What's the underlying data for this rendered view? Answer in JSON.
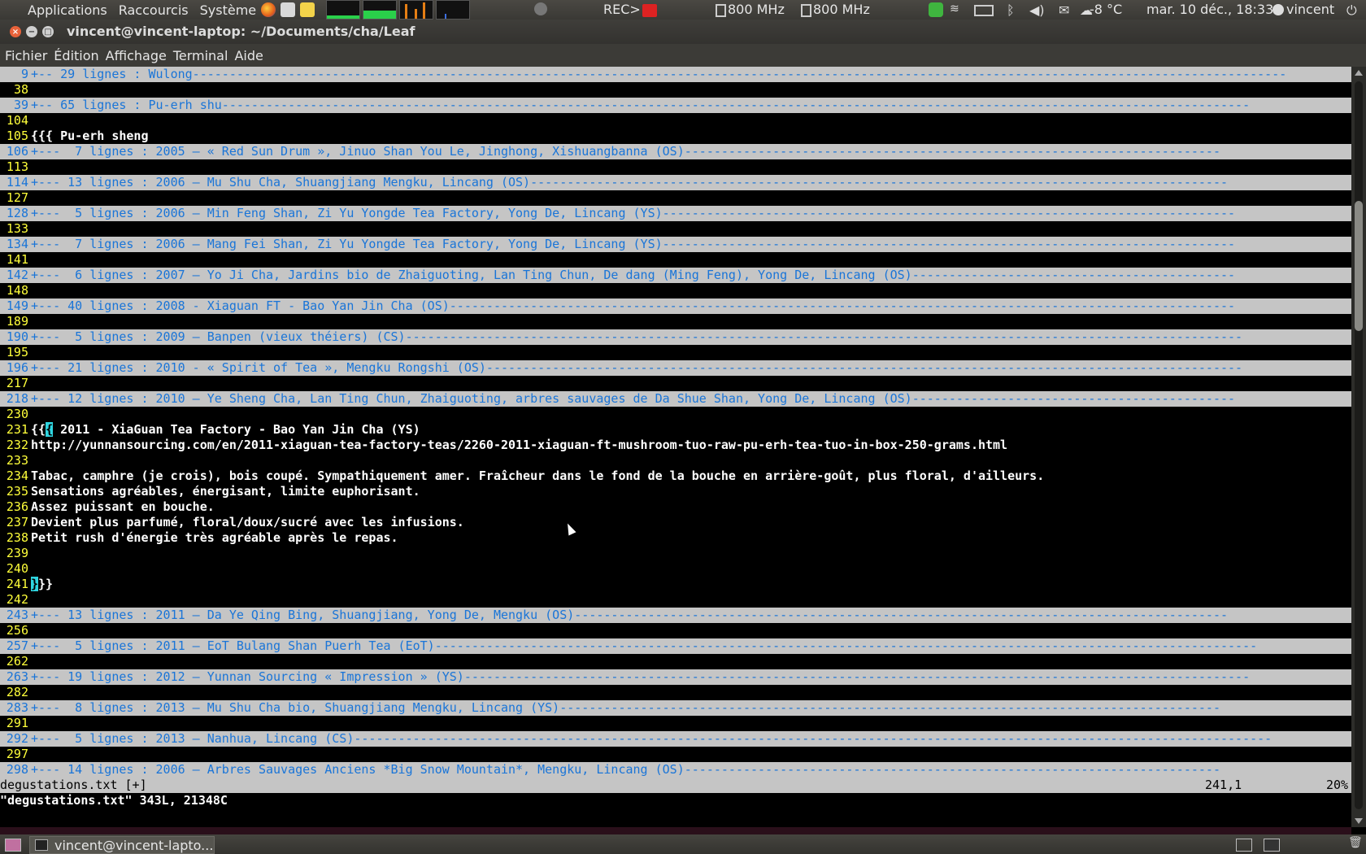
{
  "top_panel": {
    "menus": [
      "Applications",
      "Raccourcis",
      "Système"
    ],
    "rec_label": "REC>",
    "cpu1": "800 MHz",
    "cpu2": "800 MHz",
    "weather": "-8 °C",
    "datetime": "mar. 10 déc., 18:33",
    "user": "vincent"
  },
  "window": {
    "title": "vincent@vincent-laptop: ~/Documents/cha/Leaf"
  },
  "menubar": {
    "items": [
      "Fichier",
      "Édition",
      "Affichage",
      "Terminal",
      "Aide"
    ]
  },
  "editor": {
    "lines": [
      {
        "n": "9",
        "t": "+-- 29 lignes : Wulong-----------------------------------------------------------------------------------------------------------------------------------------------------",
        "fold": true
      },
      {
        "n": "38",
        "t": "",
        "fold": false
      },
      {
        "n": "39",
        "t": "+-- 65 lignes : Pu-erh shu--------------------------------------------------------------------------------------------------------------------------------------------",
        "fold": true
      },
      {
        "n": "104",
        "t": "",
        "fold": false
      },
      {
        "n": "105",
        "t": "{{{ Pu-erh sheng",
        "fold": false
      },
      {
        "n": "106",
        "t": "+---  7 lignes : 2005 — « Red Sun Drum », Jinuo Shan You Le, Jinghong, Xishuangbanna (OS)-------------------------------------------------------------------------",
        "fold": true
      },
      {
        "n": "113",
        "t": "",
        "fold": false
      },
      {
        "n": "114",
        "t": "+--- 13 lignes : 2006 — Mu Shu Cha, Shuangjiang Mengku, Lincang (OS)-----------------------------------------------------------------------------------------------",
        "fold": true
      },
      {
        "n": "127",
        "t": "",
        "fold": false
      },
      {
        "n": "128",
        "t": "+---  5 lignes : 2006 — Min Feng Shan, Zi Yu Yongde Tea Factory, Yong De, Lincang (YS)------------------------------------------------------------------------------",
        "fold": true
      },
      {
        "n": "133",
        "t": "",
        "fold": false
      },
      {
        "n": "134",
        "t": "+---  7 lignes : 2006 — Mang Fei Shan, Zi Yu Yongde Tea Factory, Yong De, Lincang (YS)------------------------------------------------------------------------------",
        "fold": true
      },
      {
        "n": "141",
        "t": "",
        "fold": false
      },
      {
        "n": "142",
        "t": "+---  6 lignes : 2007 — Yo Ji Cha, Jardins bio de Zhaiguoting, Lan Ting Chun, De dang (Ming Feng), Yong De, Lincang (OS)--------------------------------------------",
        "fold": true
      },
      {
        "n": "148",
        "t": "",
        "fold": false
      },
      {
        "n": "149",
        "t": "+--- 40 lignes : 2008 - Xiaguan FT - Bao Yan Jin Cha (OS)-----------------------------------------------------------------------------------------------------------",
        "fold": true
      },
      {
        "n": "189",
        "t": "",
        "fold": false
      },
      {
        "n": "190",
        "t": "+---  5 lignes : 2009 — Banpen (vieux théiers) (CS)------------------------------------------------------------------------------------------------------------------",
        "fold": true
      },
      {
        "n": "195",
        "t": "",
        "fold": false
      },
      {
        "n": "196",
        "t": "+--- 21 lignes : 2010 - « Spirit of Tea », Mengku Rongshi (OS)-------------------------------------------------------------------------------------------------------",
        "fold": true
      },
      {
        "n": "217",
        "t": "",
        "fold": false
      },
      {
        "n": "218",
        "t": "+--- 12 lignes : 2010 — Ye Sheng Cha, Lan Ting Chun, Zhaiguoting, arbres sauvages de Da Shue Shan, Yong De, Lincang (OS)--------------------------------------------",
        "fold": true
      },
      {
        "n": "230",
        "t": "",
        "fold": false
      },
      {
        "n": "231",
        "t": "{{{ 2011 - XiaGuan Tea Factory - Bao Yan Jin Cha (YS)",
        "fold": false
      },
      {
        "n": "232",
        "t": "http://yunnansourcing.com/en/2011-xiaguan-tea-factory-teas/2260-2011-xiaguan-ft-mushroom-tuo-raw-pu-erh-tea-tuo-in-box-250-grams.html",
        "fold": false
      },
      {
        "n": "233",
        "t": "",
        "fold": false
      },
      {
        "n": "234",
        "t": "Tabac, camphre (je crois), bois coupé. Sympathiquement amer. Fraîcheur dans le fond de la bouche en arrière-goût, plus floral, d'ailleurs.",
        "fold": false
      },
      {
        "n": "235",
        "t": "Sensations agréables, énergisant, limite euphorisant.",
        "fold": false
      },
      {
        "n": "236",
        "t": "Assez puissant en bouche.",
        "fold": false
      },
      {
        "n": "237",
        "t": "Devient plus parfumé, floral/doux/sucré avec les infusions.",
        "fold": false
      },
      {
        "n": "238",
        "t": "Petit rush d'énergie très agréable après le repas.",
        "fold": false
      },
      {
        "n": "239",
        "t": "",
        "fold": false
      },
      {
        "n": "240",
        "t": "",
        "fold": false
      },
      {
        "n": "241",
        "t": "}}}",
        "fold": false
      },
      {
        "n": "242",
        "t": "",
        "fold": false
      },
      {
        "n": "243",
        "t": "+--- 13 lignes : 2011 — Da Ye Qing Bing, Shuangjiang, Yong De, Mengku (OS)-----------------------------------------------------------------------------------------",
        "fold": true
      },
      {
        "n": "256",
        "t": "",
        "fold": false
      },
      {
        "n": "257",
        "t": "+---  5 lignes : 2011 — EoT Bulang Shan Puerh Tea (EoT)----------------------------------------------------------------------------------------------------------------",
        "fold": true
      },
      {
        "n": "262",
        "t": "",
        "fold": false
      },
      {
        "n": "263",
        "t": "+--- 19 lignes : 2012 — Yunnan Sourcing « Impression » (YS)-----------------------------------------------------------------------------------------------------------",
        "fold": true
      },
      {
        "n": "282",
        "t": "",
        "fold": false
      },
      {
        "n": "283",
        "t": "+---  8 lignes : 2013 — Mu Shu Cha bio, Shuangjiang Mengku, Lincang (YS)------------------------------------------------------------------------------------------",
        "fold": true
      },
      {
        "n": "291",
        "t": "",
        "fold": false
      },
      {
        "n": "292",
        "t": "+---  5 lignes : 2013 — Nanhua, Lincang (CS)-----------------------------------------------------------------------------------------------------------------------------",
        "fold": true
      },
      {
        "n": "297",
        "t": "",
        "fold": false
      },
      {
        "n": "298",
        "t": "+--- 14 lignes : 2006 — Arbres Sauvages Anciens *Big Snow Mountain*, Mengku, Lincang (OS)-------------------------------------------------------------------------",
        "fold": true
      }
    ],
    "status": {
      "filename": "degustations.txt [+]",
      "position": "241,1",
      "percent": "20%"
    },
    "message": "\"degustations.txt\" 343L, 21348C",
    "scroll_fraction": 0.2
  },
  "taskbar": {
    "task_label": "vincent@vincent-lapto..."
  }
}
